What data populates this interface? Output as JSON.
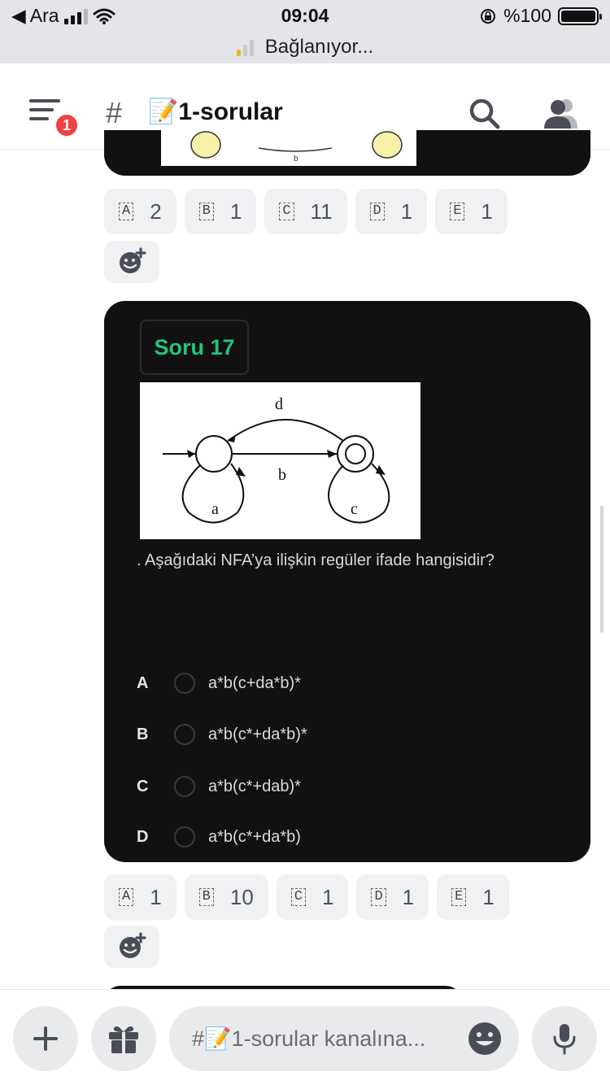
{
  "status_bar": {
    "back_label": "◀ Ara",
    "time": "09:04",
    "battery_text": "%100",
    "connecting_text": "Bağlanıyor..."
  },
  "header": {
    "notification_count": "1",
    "hash": "#",
    "channel_title": "📝1-sorular"
  },
  "top_reactions": [
    {
      "letter": "A",
      "count": "2"
    },
    {
      "letter": "B",
      "count": "1"
    },
    {
      "letter": "C",
      "count": "11"
    },
    {
      "letter": "D",
      "count": "1"
    },
    {
      "letter": "E",
      "count": "1"
    }
  ],
  "top_image_caption": "b",
  "question_card": {
    "title": "Soru 17",
    "diagram_labels": {
      "d": "d",
      "b": "b",
      "a": "a",
      "c": "c"
    },
    "question": ". Aşağıdaki NFA’ya ilişkin regüler ifade hangisidir?",
    "options": [
      {
        "letter": "A",
        "text": "a*b(c+da*b)*"
      },
      {
        "letter": "B",
        "text": "a*b(c*+da*b)*"
      },
      {
        "letter": "C",
        "text": "a*b(c*+dab)*"
      },
      {
        "letter": "D",
        "text": "a*b(c*+da*b)"
      }
    ]
  },
  "bottom_reactions": [
    {
      "letter": "A",
      "count": "1"
    },
    {
      "letter": "B",
      "count": "10"
    },
    {
      "letter": "C",
      "count": "1"
    },
    {
      "letter": "D",
      "count": "1"
    },
    {
      "letter": "E",
      "count": "1"
    }
  ],
  "composer": {
    "placeholder": "#📝1-sorular kanalına..."
  },
  "icons": {
    "menu": "hamburger-icon",
    "search": "search-icon",
    "members": "members-icon",
    "add_reaction": "add-reaction-icon",
    "plus": "plus-icon",
    "gift": "gift-icon",
    "emoji": "emoji-icon",
    "mic": "microphone-icon"
  },
  "colors": {
    "accent_green": "#22c57e",
    "badge_red": "#ed4245",
    "card_bg": "#111111"
  }
}
